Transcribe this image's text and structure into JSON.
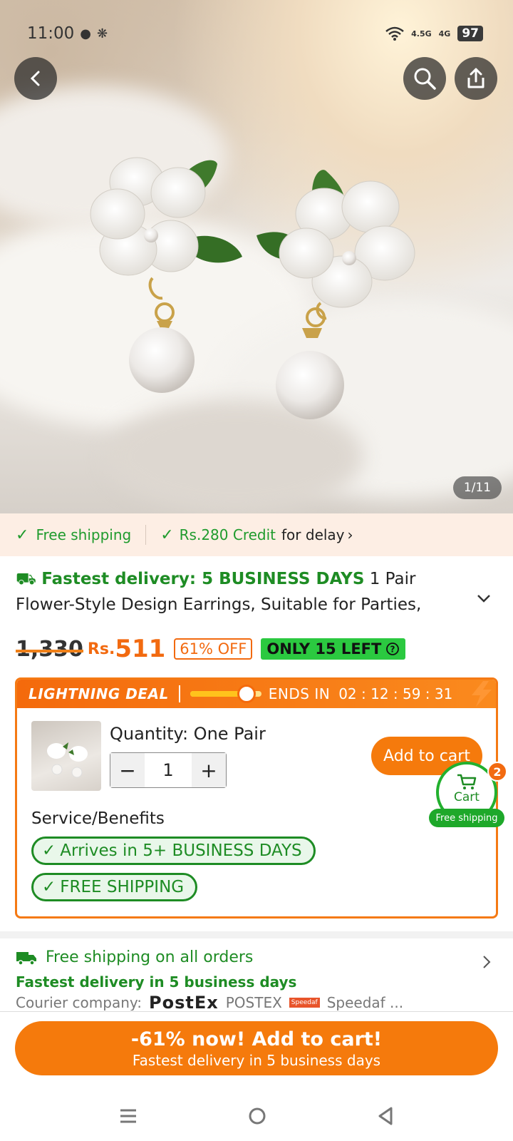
{
  "status_bar": {
    "time": "11:00",
    "network1": "4.5G",
    "network2": "4G",
    "battery": "97"
  },
  "gallery": {
    "counter": "1/11"
  },
  "shipping_strip": {
    "free_shipping": "Free shipping",
    "credit": "Rs.280 Credit",
    "credit_suffix": "for delay"
  },
  "product": {
    "delivery_prefix": "Fastest delivery: 5 BUSINESS DAYS",
    "title_line1": "1 Pair",
    "title_line2": "Flower-Style Design Earrings, Suitable for Parties,"
  },
  "price": {
    "old": "1,330",
    "currency": "Rs.",
    "current": "511",
    "discount": "61% OFF",
    "stock": "ONLY 15 LEFT"
  },
  "deal": {
    "label": "LIGHTNING DEAL",
    "ends_label": "ENDS IN",
    "countdown": "02 : 12 : 59 : 31",
    "progress": 0.7,
    "quantity_label": "Quantity: One Pair",
    "quantity_value": "1",
    "add_to_cart": "Add to cart",
    "service_label": "Service/Benefits",
    "benefit1": "Arrives in 5+ BUSINESS DAYS",
    "benefit2": "FREE SHIPPING"
  },
  "cart": {
    "label": "Cart",
    "count": "2",
    "free_shipping": "Free shipping"
  },
  "shipping_info": {
    "line1": "Free shipping on all orders",
    "line2": "Fastest delivery in 5 business days",
    "courier_label": "Courier company:",
    "courier1_logo": "PostEx",
    "courier1": "POSTEX",
    "courier2": "Speedaf ..."
  },
  "cta": {
    "line1": "-61% now! Add to cart!",
    "line2": "Fastest delivery in 5 business days"
  },
  "colors": {
    "accent": "#f57a0c",
    "green": "#1e8c24",
    "badge_green": "#2bc940"
  }
}
